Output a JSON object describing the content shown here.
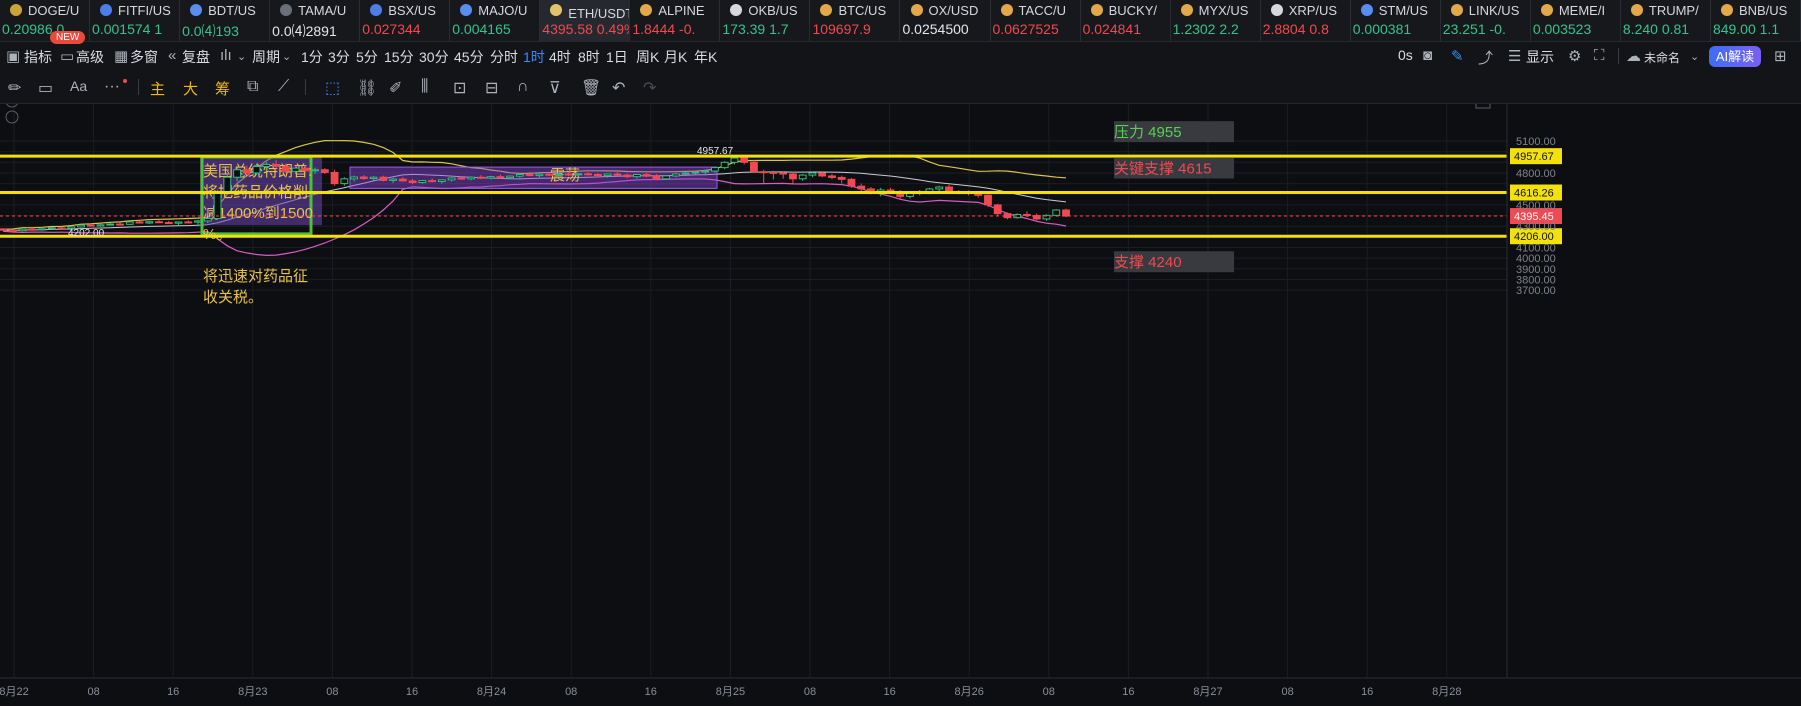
{
  "ticker": [
    {
      "name": "DOGE/U",
      "value": "0.20986 0",
      "dir": "up",
      "icon": "doge-coin-icon",
      "color": "#c9a53a"
    },
    {
      "name": "FITFI/US",
      "value": "0.001574 1",
      "dir": "up",
      "icon": "fitfi-coin-icon",
      "color": "#4d7ee8"
    },
    {
      "name": "BDT/US",
      "value": "0.0⑷193",
      "dir": "up",
      "icon": "bdt-coin-icon",
      "color": "#5a8df0"
    },
    {
      "name": "TAMA/U",
      "value": "0.0⑷2891",
      "dir": "nt",
      "icon": "tama-coin-icon",
      "color": "#6b6f7a"
    },
    {
      "name": "BSX/US",
      "value": "0.027344",
      "dir": "dn",
      "icon": "bsx-coin-icon",
      "color": "#4d7ee8"
    },
    {
      "name": "MAJO/U",
      "value": "0.004165",
      "dir": "up",
      "icon": "majo-coin-icon",
      "color": "#5a8df0"
    },
    {
      "name": "ETH/USDT永续",
      "value": "4395.58  0.49%",
      "dir": "dn",
      "icon": "eth-coin-icon",
      "color": "#e3c36a",
      "active": true
    },
    {
      "name": "ALPINE",
      "value": "1.8444 -0.",
      "dir": "dn",
      "icon": "alpine-coin-icon",
      "color": "#e3a84a"
    },
    {
      "name": "OKB/US",
      "value": "173.39 1.7",
      "dir": "up",
      "icon": "okb-icon",
      "color": "#d6d8de"
    },
    {
      "name": "BTC/US",
      "value": "109697.9",
      "dir": "dn",
      "icon": "btc-coin-icon",
      "color": "#e3a84a"
    },
    {
      "name": "OX/USD",
      "value": "0.0254500",
      "dir": "nt",
      "icon": "ox-coin-icon",
      "color": "#e3a84a"
    },
    {
      "name": "TACC/U",
      "value": "0.0627525",
      "dir": "dn",
      "icon": "tacc-coin-icon",
      "color": "#e3a84a"
    },
    {
      "name": "BUCKY/",
      "value": "0.024841",
      "dir": "dn",
      "icon": "bucky-coin-icon",
      "color": "#e3a84a"
    },
    {
      "name": "MYX/US",
      "value": "1.2302 2.2",
      "dir": "up",
      "icon": "myx-coin-icon",
      "color": "#e3a84a"
    },
    {
      "name": "XRP/US",
      "value": "2.8804 0.8",
      "dir": "dn",
      "icon": "xrp-icon",
      "color": "#d6d8de"
    },
    {
      "name": "STM/US",
      "value": "0.000381",
      "dir": "up",
      "icon": "stm-coin-icon",
      "color": "#5a8df0"
    },
    {
      "name": "LINK/US",
      "value": "23.251 -0.",
      "dir": "up",
      "icon": "link-coin-icon",
      "color": "#e3a84a"
    },
    {
      "name": "MEME/I",
      "value": "0.003523",
      "dir": "up",
      "icon": "meme-coin-icon",
      "color": "#e3a84a"
    },
    {
      "name": "TRUMP/",
      "value": "8.240 0.81",
      "dir": "up",
      "icon": "trump-coin-icon",
      "color": "#e3a84a"
    },
    {
      "name": "BNB/US",
      "value": "849.00 1.1",
      "dir": "up",
      "icon": "bnb-coin-icon",
      "color": "#e3a84a"
    }
  ],
  "toolbar1": {
    "indicators": "指标",
    "advanced": "高级",
    "new_badge": "NEW",
    "multi_window": "多窗",
    "replay": "复盘",
    "period": "周期",
    "intervals": [
      "1分",
      "3分",
      "5分",
      "15分",
      "30分",
      "45分",
      "分时",
      "1时",
      "4时",
      "8时",
      "1日",
      "周K",
      "月K",
      "年K"
    ],
    "active_interval": "1时",
    "seconds": "0s",
    "display": "显示",
    "unnamed": "未命名",
    "ai_read": "AI解读"
  },
  "toolbar2": {
    "main": "主",
    "big": "大",
    "chip": "筹"
  },
  "chart_data": {
    "type": "candlestick",
    "symbol": "ETH/USDT永续",
    "last_price": 4395.45,
    "last_price_label": "4395.45",
    "y_ticks": [
      5100,
      5000,
      4900,
      4800,
      4700,
      4600,
      4500,
      4400,
      4300,
      4200,
      4100,
      4000,
      3900,
      3800,
      3700
    ],
    "x_ticks": [
      "8月22",
      "08",
      "16",
      "8月23",
      "08",
      "16",
      "8月24",
      "08",
      "16",
      "8月25",
      "08",
      "16",
      "8月26",
      "08",
      "16",
      "8月27",
      "08",
      "16",
      "8月28"
    ],
    "price_lines": [
      {
        "price": 4957.67,
        "axis_label": "4957.67",
        "annotation": "压力 4955",
        "annotation_color": "#57d152"
      },
      {
        "price": 4616.26,
        "axis_label": "4616.26",
        "annotation": "关键支撑 4615",
        "annotation_color": "#f0494f"
      },
      {
        "price": 4206.0,
        "axis_label": "4206.00",
        "annotation": "支撑 4240",
        "annotation_color": "#f0494f"
      }
    ],
    "high_marker": "4957.67",
    "low_marker": "4202.00",
    "note_box_text": "美国总统特朗普:将把药品价格削减1400%到1500%。\n\n将迅速对药品征收关税。",
    "range_box_text": "震荡",
    "candles": [
      [
        4275,
        4282,
        4255,
        4262
      ],
      [
        4262,
        4270,
        4248,
        4258
      ],
      [
        4258,
        4275,
        4252,
        4272
      ],
      [
        4272,
        4285,
        4262,
        4268
      ],
      [
        4268,
        4280,
        4258,
        4275
      ],
      [
        4275,
        4290,
        4266,
        4284
      ],
      [
        4284,
        4296,
        4270,
        4279
      ],
      [
        4279,
        4298,
        4274,
        4293
      ],
      [
        4293,
        4315,
        4286,
        4310
      ],
      [
        4310,
        4320,
        4296,
        4302
      ],
      [
        4302,
        4318,
        4296,
        4313
      ],
      [
        4313,
        4330,
        4305,
        4320
      ],
      [
        4320,
        4335,
        4310,
        4318
      ],
      [
        4318,
        4345,
        4312,
        4340
      ],
      [
        4340,
        4352,
        4325,
        4330
      ],
      [
        4330,
        4348,
        4320,
        4342
      ],
      [
        4342,
        4360,
        4330,
        4335
      ],
      [
        4335,
        4350,
        4322,
        4328
      ],
      [
        4328,
        4345,
        4310,
        4340
      ],
      [
        4340,
        4355,
        4328,
        4338
      ],
      [
        4338,
        4360,
        4300,
        4350
      ],
      [
        4350,
        4380,
        4330,
        4372
      ],
      [
        4372,
        4640,
        4360,
        4620
      ],
      [
        4620,
        4780,
        4600,
        4760
      ],
      [
        4760,
        4850,
        4720,
        4830
      ],
      [
        4830,
        4870,
        4780,
        4800
      ],
      [
        4800,
        4890,
        4780,
        4860
      ],
      [
        4860,
        4900,
        4820,
        4880
      ],
      [
        4880,
        4920,
        4840,
        4862
      ],
      [
        4862,
        4890,
        4800,
        4815
      ],
      [
        4815,
        4860,
        4790,
        4845
      ],
      [
        4845,
        4870,
        4810,
        4820
      ],
      [
        4820,
        4850,
        4790,
        4830
      ],
      [
        4830,
        4845,
        4790,
        4805
      ],
      [
        4805,
        4830,
        4680,
        4700
      ],
      [
        4700,
        4760,
        4680,
        4745
      ],
      [
        4745,
        4775,
        4720,
        4762
      ],
      [
        4762,
        4780,
        4735,
        4748
      ],
      [
        4748,
        4770,
        4725,
        4760
      ],
      [
        4760,
        4775,
        4720,
        4730
      ],
      [
        4730,
        4755,
        4705,
        4742
      ],
      [
        4742,
        4760,
        4718,
        4725
      ],
      [
        4725,
        4745,
        4695,
        4710
      ],
      [
        4710,
        4735,
        4700,
        4728
      ],
      [
        4728,
        4750,
        4712,
        4720
      ],
      [
        4720,
        4740,
        4700,
        4735
      ],
      [
        4735,
        4760,
        4720,
        4752
      ],
      [
        4752,
        4770,
        4735,
        4745
      ],
      [
        4745,
        4768,
        4730,
        4760
      ],
      [
        4760,
        4780,
        4742,
        4752
      ],
      [
        4752,
        4772,
        4740,
        4765
      ],
      [
        4765,
        4785,
        4748,
        4756
      ],
      [
        4756,
        4778,
        4745,
        4770
      ],
      [
        4770,
        4800,
        4755,
        4785
      ],
      [
        4785,
        4810,
        4768,
        4775
      ],
      [
        4775,
        4795,
        4760,
        4788
      ],
      [
        4788,
        4805,
        4770,
        4780
      ],
      [
        4780,
        4800,
        4765,
        4790
      ],
      [
        4790,
        4810,
        4772,
        4782
      ],
      [
        4782,
        4800,
        4768,
        4792
      ],
      [
        4792,
        4808,
        4775,
        4785
      ],
      [
        4785,
        4800,
        4760,
        4775
      ],
      [
        4775,
        4795,
        4755,
        4790
      ],
      [
        4790,
        4808,
        4770,
        4780
      ],
      [
        4780,
        4796,
        4750,
        4765
      ],
      [
        4765,
        4790,
        4748,
        4785
      ],
      [
        4785,
        4800,
        4760,
        4770
      ],
      [
        4770,
        4790,
        4735,
        4745
      ],
      [
        4745,
        4780,
        4735,
        4772
      ],
      [
        4772,
        4800,
        4760,
        4790
      ],
      [
        4790,
        4810,
        4770,
        4800
      ],
      [
        4800,
        4818,
        4780,
        4808
      ],
      [
        4808,
        4830,
        4790,
        4818
      ],
      [
        4818,
        4860,
        4805,
        4850
      ],
      [
        4850,
        4910,
        4835,
        4900
      ],
      [
        4900,
        4957,
        4880,
        4940
      ],
      [
        4940,
        4950,
        4880,
        4900
      ],
      [
        4900,
        4920,
        4800,
        4812
      ],
      [
        4812,
        4830,
        4700,
        4805
      ],
      [
        4805,
        4820,
        4740,
        4800
      ],
      [
        4800,
        4815,
        4745,
        4790
      ],
      [
        4790,
        4812,
        4700,
        4745
      ],
      [
        4745,
        4790,
        4725,
        4780
      ],
      [
        4780,
        4810,
        4760,
        4800
      ],
      [
        4800,
        4812,
        4760,
        4772
      ],
      [
        4772,
        4790,
        4740,
        4758
      ],
      [
        4758,
        4775,
        4700,
        4740
      ],
      [
        4740,
        4752,
        4660,
        4676
      ],
      [
        4676,
        4700,
        4630,
        4650
      ],
      [
        4650,
        4668,
        4600,
        4620
      ],
      [
        4620,
        4660,
        4580,
        4640
      ],
      [
        4640,
        4660,
        4610,
        4625
      ],
      [
        4625,
        4640,
        4560,
        4580
      ],
      [
        4580,
        4620,
        4560,
        4610
      ],
      [
        4610,
        4640,
        4590,
        4625
      ],
      [
        4625,
        4660,
        4600,
        4650
      ],
      [
        4650,
        4680,
        4630,
        4668
      ],
      [
        4668,
        4690,
        4615,
        4625
      ],
      [
        4625,
        4640,
        4600,
        4620
      ],
      [
        4620,
        4635,
        4590,
        4608
      ],
      [
        4608,
        4622,
        4570,
        4590
      ],
      [
        4590,
        4600,
        4480,
        4500
      ],
      [
        4500,
        4510,
        4400,
        4418
      ],
      [
        4418,
        4430,
        4365,
        4380
      ],
      [
        4380,
        4420,
        4370,
        4410
      ],
      [
        4410,
        4440,
        4385,
        4400
      ],
      [
        4400,
        4420,
        4355,
        4368
      ],
      [
        4368,
        4412,
        4350,
        4402
      ],
      [
        4402,
        4460,
        4390,
        4452
      ],
      [
        4452,
        4465,
        4385,
        4395
      ]
    ]
  }
}
